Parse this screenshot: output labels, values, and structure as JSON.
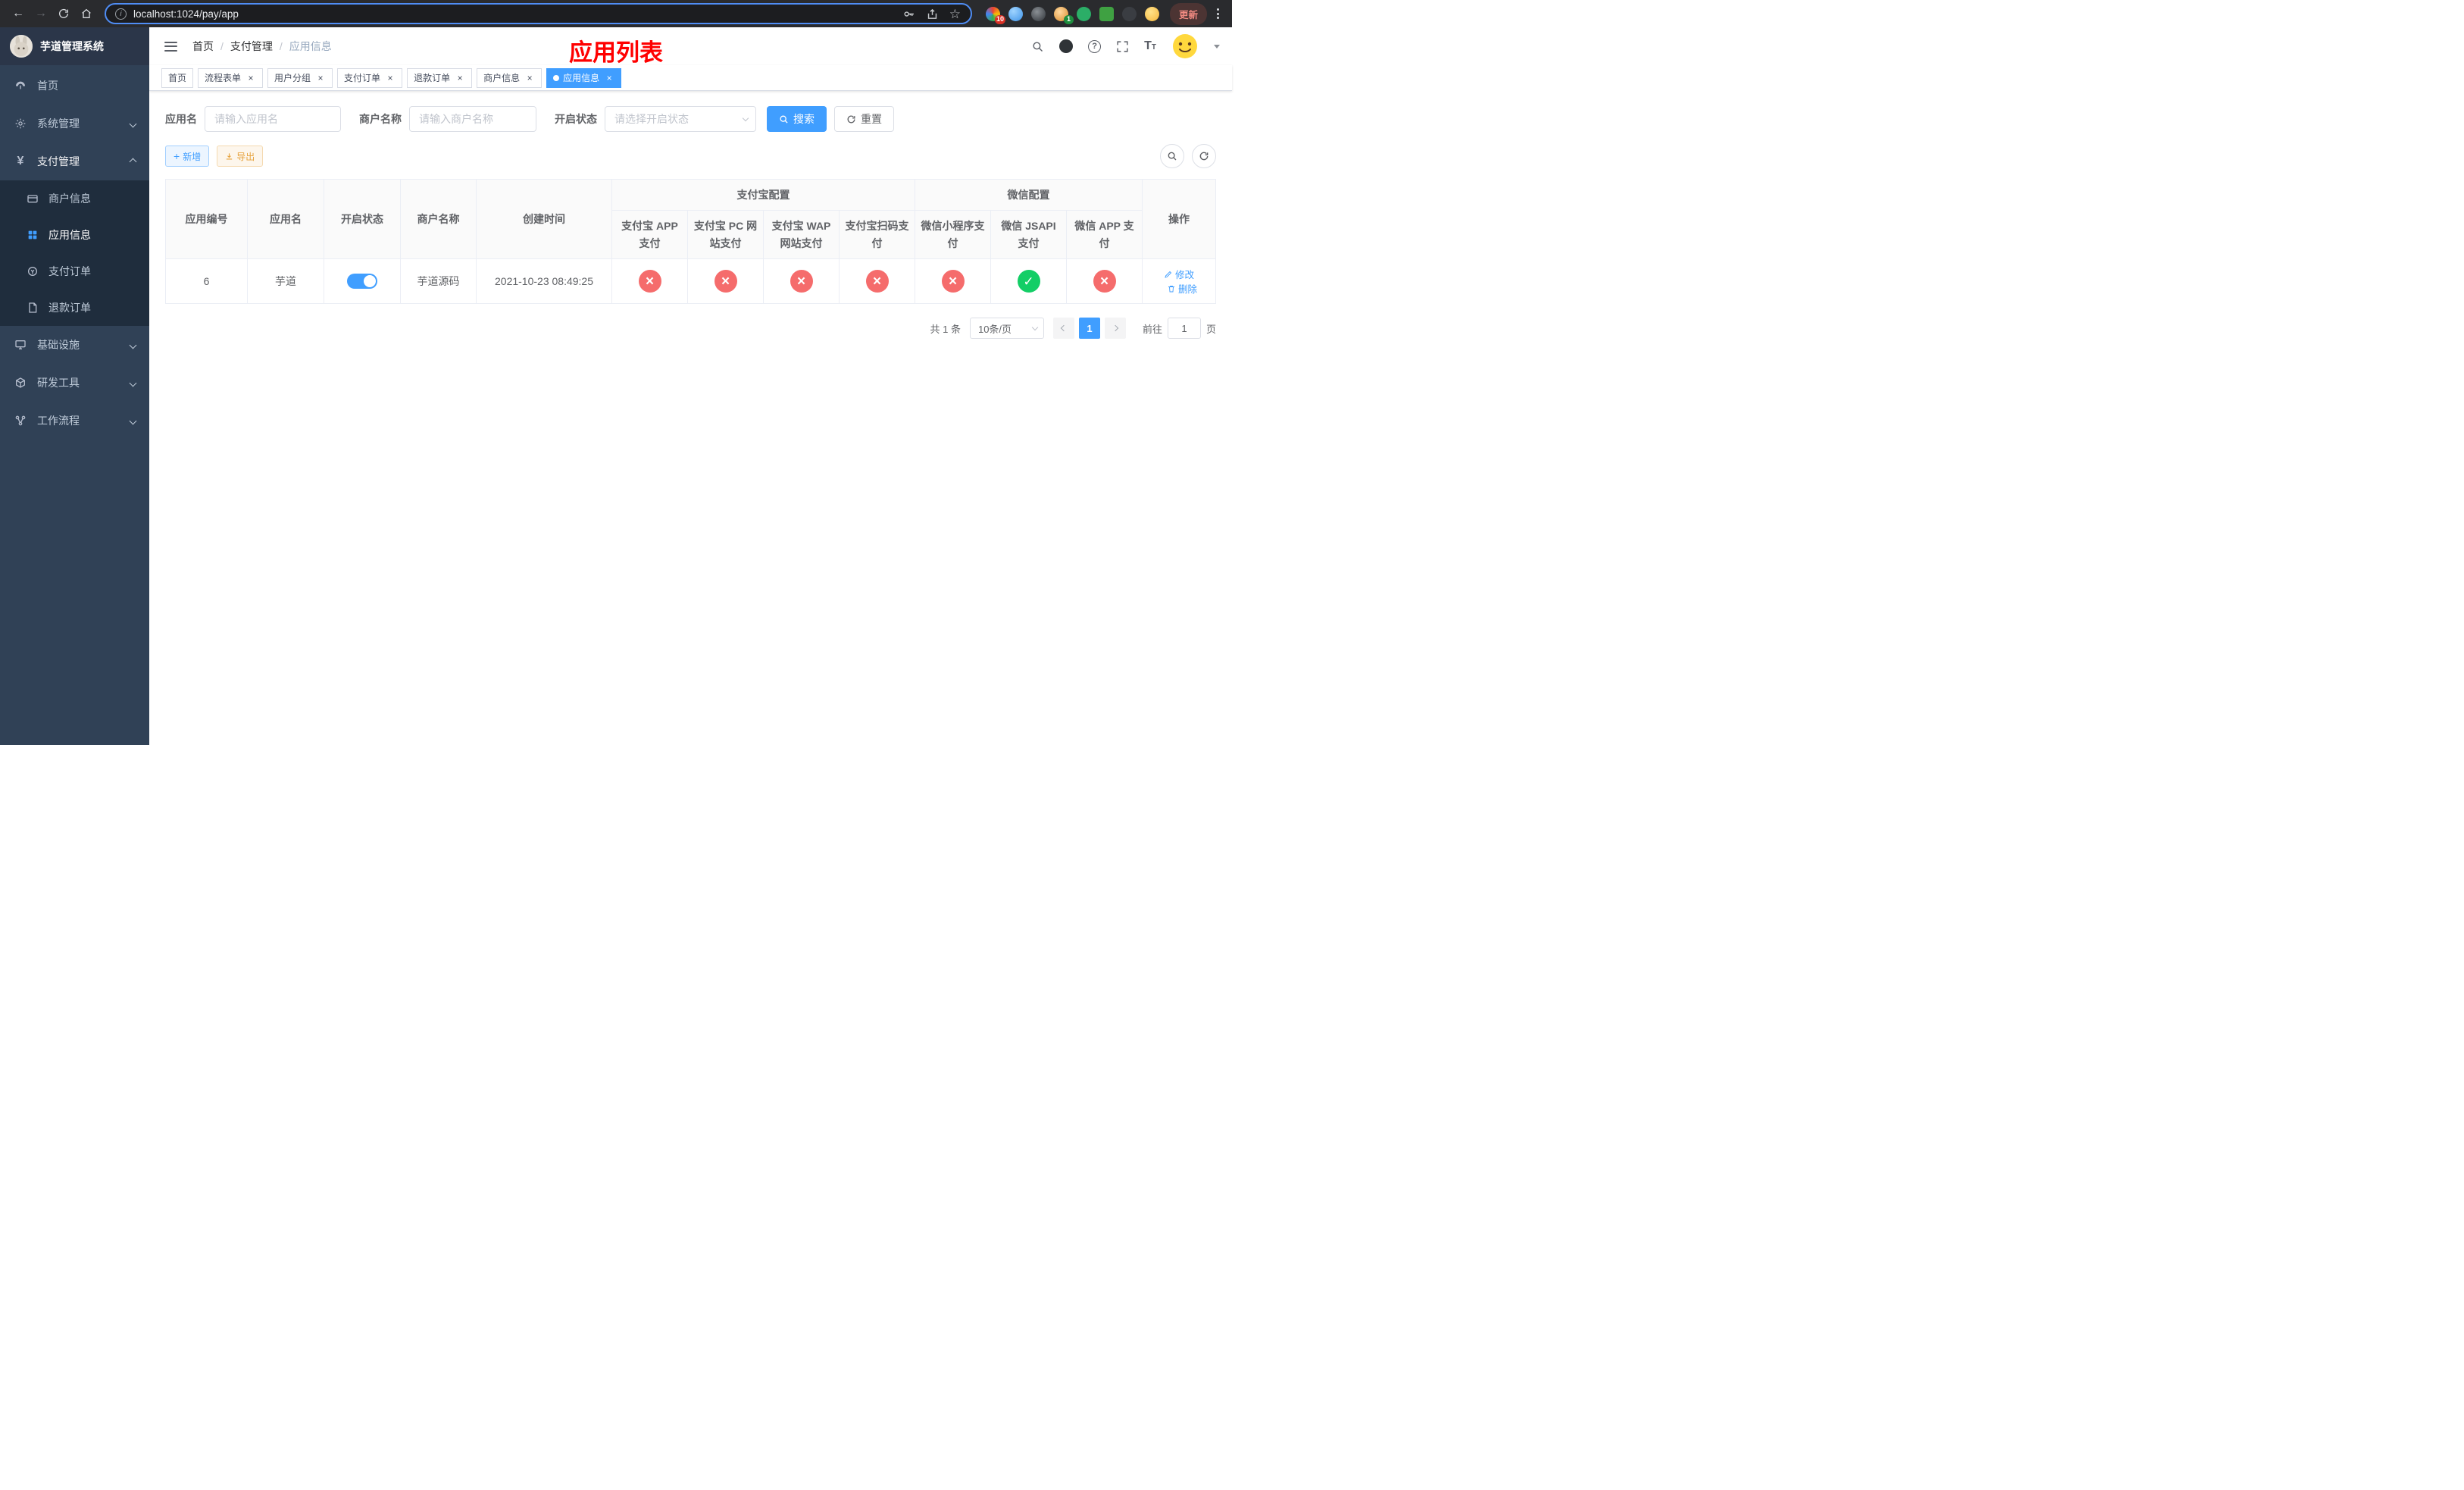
{
  "browser": {
    "url": "localhost:1024/pay/app",
    "update_label": "更新",
    "ext_badge_red": "10",
    "ext_badge_green": "1"
  },
  "sidebar": {
    "title": "芋道管理系统",
    "items": {
      "home": "首页",
      "system": "系统管理",
      "payment": "支付管理",
      "infra": "基础设施",
      "devtools": "研发工具",
      "workflow": "工作流程"
    },
    "payment_children": {
      "merchant": "商户信息",
      "app": "应用信息",
      "order": "支付订单",
      "refund": "退款订单"
    }
  },
  "navbar": {
    "breadcrumb": [
      "首页",
      "支付管理",
      "应用信息"
    ],
    "annotation_title": "应用列表"
  },
  "tabs": [
    {
      "label": "首页"
    },
    {
      "label": "流程表单"
    },
    {
      "label": "用户分组"
    },
    {
      "label": "支付订单"
    },
    {
      "label": "退款订单"
    },
    {
      "label": "商户信息"
    },
    {
      "label": "应用信息"
    }
  ],
  "filters": {
    "app_name_label": "应用名",
    "app_name_placeholder": "请输入应用名",
    "merchant_label": "商户名称",
    "merchant_placeholder": "请输入商户名称",
    "status_label": "开启状态",
    "status_placeholder": "请选择开启状态",
    "search_label": "搜索",
    "reset_label": "重置"
  },
  "toolbar": {
    "add_label": "新增",
    "export_label": "导出"
  },
  "table": {
    "headers": {
      "app_id": "应用编号",
      "app_name": "应用名",
      "status": "开启状态",
      "merchant_name": "商户名称",
      "create_time": "创建时间",
      "alipay_group": "支付宝配置",
      "wechat_group": "微信配置",
      "alipay_app": "支付宝 APP 支付",
      "alipay_pc": "支付宝 PC 网站支付",
      "alipay_wap": "支付宝 WAP 网站支付",
      "alipay_qr": "支付宝扫码支付",
      "wx_mini": "微信小程序支付",
      "wx_jsapi": "微信 JSAPI 支付",
      "wx_app": "微信 APP 支付",
      "actions": "操作"
    },
    "row": {
      "id": "6",
      "name": "芋道",
      "status": "on",
      "merchant": "芋道源码",
      "created": "2021-10-23 08:49:25",
      "configs": [
        "disabled",
        "disabled",
        "disabled",
        "disabled",
        "disabled",
        "enabled",
        "disabled"
      ],
      "edit_label": "修改",
      "delete_label": "删除"
    }
  },
  "pagination": {
    "total": "共 1 条",
    "page_size": "10条/页",
    "page": "1",
    "goto_label": "前往",
    "goto_value": "1",
    "goto_unit": "页"
  },
  "colors": {
    "accent": "#409eff",
    "danger": "#f56c6c",
    "success": "#13ce66",
    "warning": "#e6a23c",
    "sidebar_bg": "#304156",
    "submenu_bg": "#1f2d3d",
    "annotation_red": "#ff0000"
  }
}
